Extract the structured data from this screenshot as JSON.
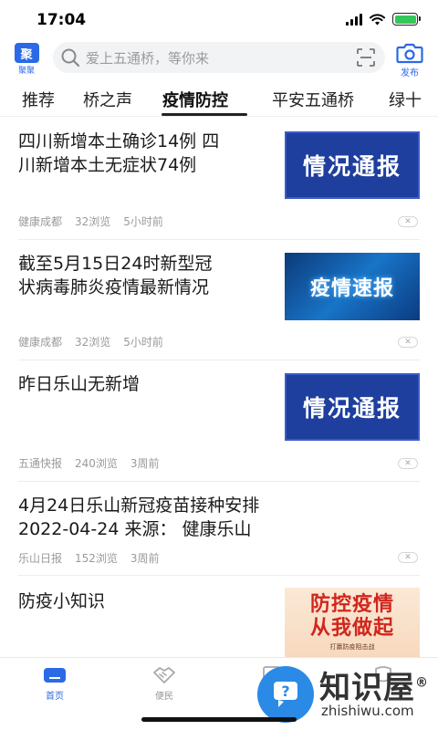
{
  "status": {
    "time": "17:04"
  },
  "header": {
    "logo_text": "聚",
    "logo_label": "聚聚",
    "search_placeholder": "爱上五通桥，等你来",
    "publish_label": "发布"
  },
  "tabs": [
    {
      "label": "推荐"
    },
    {
      "label": "桥之声"
    },
    {
      "label": "疫情防控",
      "active": true
    },
    {
      "label": "平安五通桥"
    },
    {
      "label": "绿十"
    }
  ],
  "news": [
    {
      "title_lines": [
        "四川新增本土确诊14例 四",
        "川新增本土无症状74例"
      ],
      "source": "健康成都",
      "views": "32浏览",
      "time": "5小时前",
      "thumb_text": "情况通报"
    },
    {
      "title_lines": [
        "截至5月15日24时新型冠",
        "状病毒肺炎疫情最新情况"
      ],
      "source": "健康成都",
      "views": "32浏览",
      "time": "5小时前",
      "thumb_text": "疫情速报"
    },
    {
      "title_lines": [
        "昨日乐山无新增"
      ],
      "source": "五通快报",
      "views": "240浏览",
      "time": "3周前",
      "thumb_text": "情况通报"
    },
    {
      "title_lines": [
        "4月24日乐山新冠疫苗接种安排",
        "2022-04-24 来源： 健康乐山"
      ],
      "source": "乐山日报",
      "views": "152浏览",
      "time": "3周前"
    },
    {
      "title_lines": [
        "防疫小知识"
      ],
      "thumb_line1": "防控疫情",
      "thumb_line2": "从我做起",
      "thumb_small": "打赢防疫阻击战"
    }
  ],
  "bottom_nav": [
    {
      "label": "首页",
      "icon": "home-icon",
      "active": true
    },
    {
      "label": "便民",
      "icon": "handshake-icon"
    },
    {
      "label": "",
      "icon": "news-icon"
    },
    {
      "label": "",
      "icon": "profile-icon"
    }
  ],
  "watermark": {
    "name": "知识屋",
    "url": "zhishiwu.com",
    "mark": "®"
  },
  "colors": {
    "accent": "#2a6ae6",
    "thumb_blue": "#1f3f9e",
    "poster_red": "#d0261d"
  }
}
